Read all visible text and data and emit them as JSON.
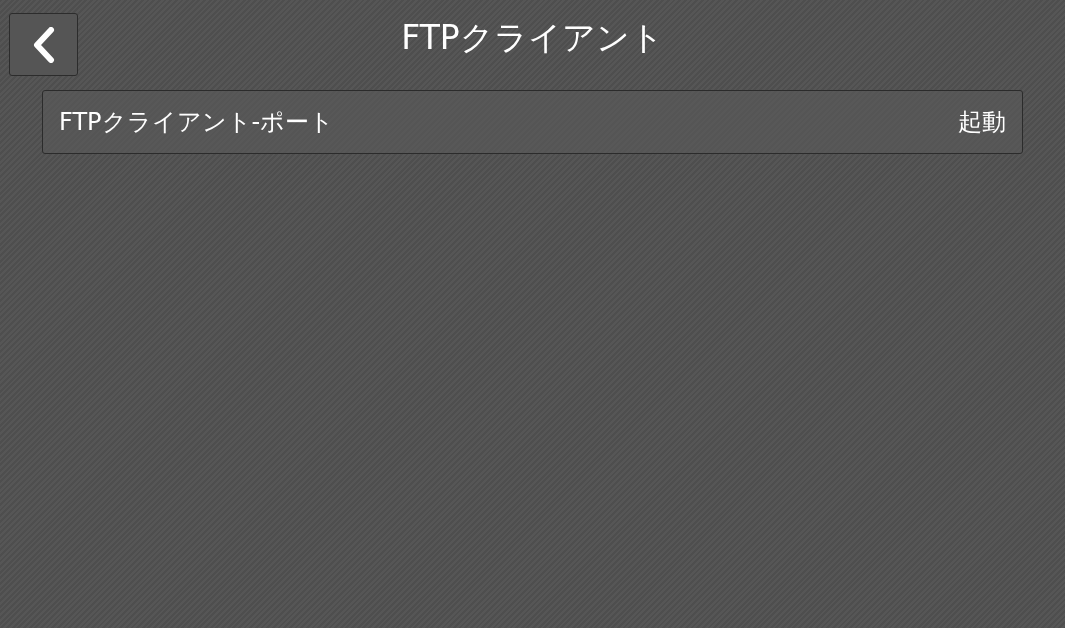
{
  "header": {
    "back_button": true,
    "title": "FTPクライアント"
  },
  "rows": [
    {
      "label": "FTPクライアント-ポート",
      "value": "起動"
    }
  ]
}
